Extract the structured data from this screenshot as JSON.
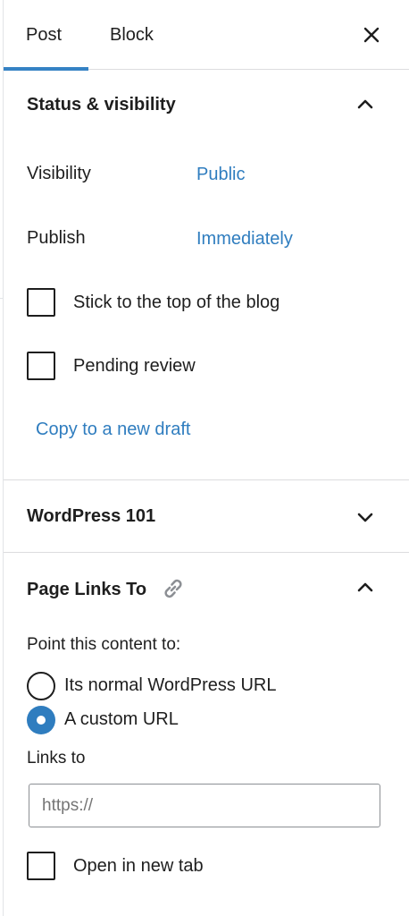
{
  "tabs": [
    {
      "label": "Post"
    },
    {
      "label": "Block"
    }
  ],
  "status_panel": {
    "title": "Status & visibility",
    "visibility_label": "Visibility",
    "visibility_value": "Public",
    "publish_label": "Publish",
    "publish_value": "Immediately",
    "sticky_label": "Stick to the top of the blog",
    "pending_label": "Pending review",
    "copy_draft": "Copy to a new draft"
  },
  "wp101_panel": {
    "title": "WordPress 101"
  },
  "page_links_panel": {
    "title": "Page Links To",
    "point_label": "Point this content to:",
    "options": [
      {
        "label": "Its normal WordPress URL",
        "checked": false
      },
      {
        "label": "A custom URL",
        "checked": true
      }
    ],
    "links_to_label": "Links to",
    "url_placeholder": "https://",
    "url_value": "",
    "new_tab_label": "Open in new tab"
  },
  "colors": {
    "accent": "#2f7dbf",
    "tab_underline": "#3582c4",
    "text": "#1e1e1e",
    "divider": "#dcdcde"
  },
  "icons": [
    "close-icon",
    "chevron-up-icon",
    "chevron-down-icon",
    "link-icon"
  ]
}
